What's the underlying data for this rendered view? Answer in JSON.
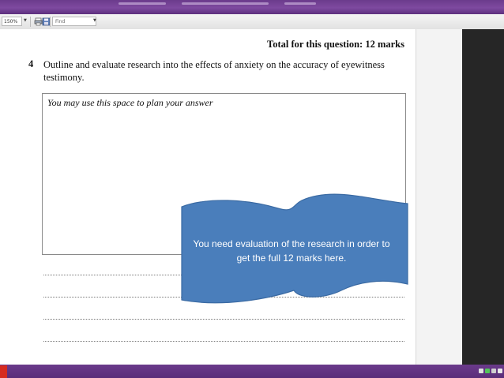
{
  "toolbar": {
    "zoom_value": "150%",
    "find_placeholder": "Find",
    "icons": [
      "print-icon",
      "save-icon"
    ]
  },
  "document": {
    "total_label": "Total for this question: 12 marks",
    "question_number": "4",
    "question_text": "Outline and evaluate research into the effects of anxiety on the accuracy of eyewitness testimony.",
    "plan_hint": "You may use this space to plan your answer"
  },
  "callout": {
    "text": "You need evaluation of the research in order to get the full 12 marks here.",
    "fill": "#4a7ebb",
    "stroke": "#3a6aa3"
  },
  "colors": {
    "window_band": "#6b3b8c",
    "dark_pane": "#262626",
    "pdf_red": "#d62b1f"
  }
}
